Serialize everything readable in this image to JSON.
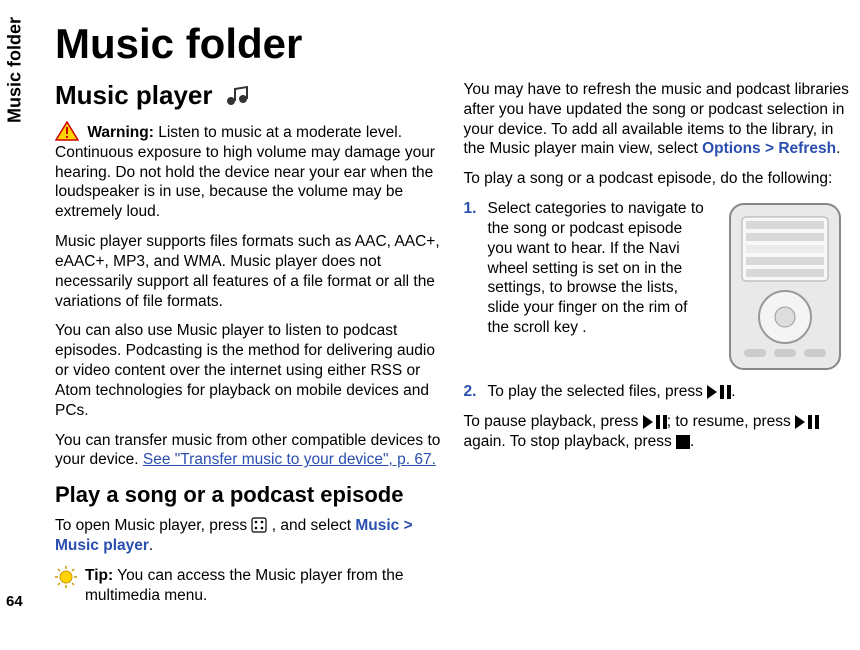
{
  "side_tab": "Music folder",
  "page_number": "64",
  "title": "Music folder",
  "music_player_heading": "Music player",
  "warning_label": "Warning:",
  "warning_text": " Listen to music at a moderate level. Continuous exposure to high volume may damage your hearing. Do not hold the device near your ear when the loudspeaker is in use, because the volume may be extremely loud.",
  "formats_text": "Music player supports files formats such as AAC, AAC+, eAAC+, MP3, and WMA. Music player does not necessarily support all features of a file format or all the variations of file formats.",
  "podcast_text": "You can also use Music player to listen to podcast episodes. Podcasting is the method for delivering audio or video content over the internet using either RSS or Atom technologies for playback on mobile devices and PCs.",
  "transfer_intro": "You can transfer music from other compatible devices to your device. ",
  "transfer_link": "See \"Transfer music to your device\", p. 67.",
  "play_heading": "Play a song or a podcast episode",
  "open_player_pre": "To open Music player, press ",
  "open_player_post": " , and select ",
  "music_label": "Music",
  "gt1": " > ",
  "music_player_label": "Music player",
  "period": ".",
  "tip_label": "Tip:",
  "tip_text": "  You can access the Music player from the multimedia menu.",
  "refresh_para_pre": "You may have to refresh the music and podcast libraries after you have updated the song or podcast selection in your device. To add all available items to the library, in the Music player main view, select ",
  "options_label": "Options",
  "gt2": " > ",
  "refresh_label": "Refresh",
  "to_play_intro": "To play a song or a podcast episode, do the following:",
  "step1": "Select categories to navigate to the song or podcast episode you want to hear. If the Navi wheel setting is set on in the settings, to browse the lists, slide your finger on the rim of the scroll key .",
  "step2_pre": "To play the selected files, press ",
  "step2_post": ".",
  "pause_pre": "To pause playback, press ",
  "pause_mid": "; to resume, press ",
  "pause_again": " again. To stop playback, press ",
  "pause_end": "."
}
